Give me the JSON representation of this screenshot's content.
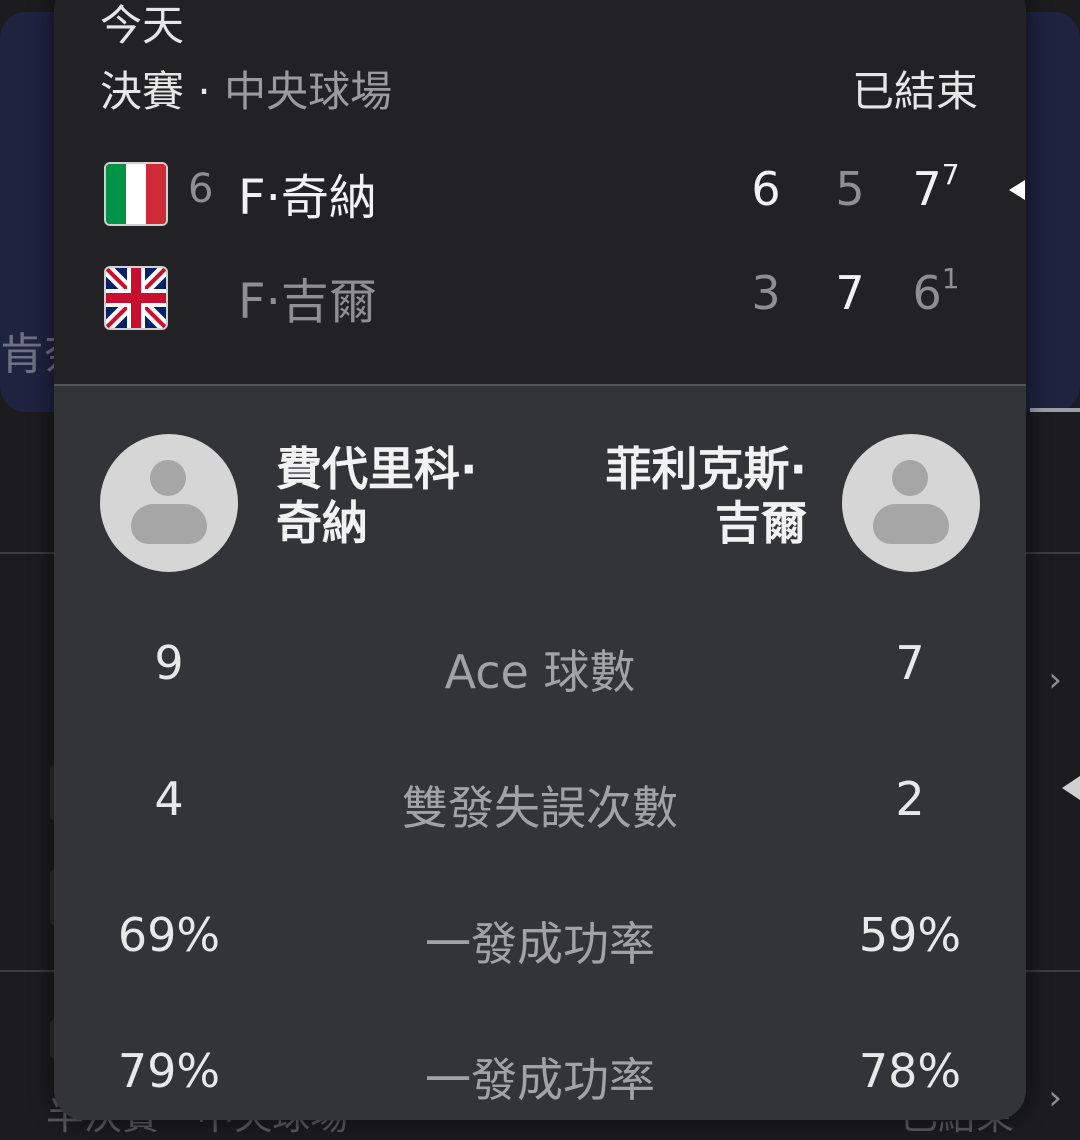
{
  "background": {
    "left_partial_text": "肯奈",
    "bottom_partial_text": "半決賽 · 中央球場",
    "bottom_partial_status": "已結束"
  },
  "match": {
    "date": "今天",
    "round": "決賽",
    "separator": "·",
    "venue": "中央球場",
    "status": "已結束",
    "players": [
      {
        "flag": "italy-flag",
        "seed": "6",
        "short_name": "F·奇納",
        "sets": [
          {
            "score": "6",
            "tiebreak": ""
          },
          {
            "score": "5",
            "tiebreak": ""
          },
          {
            "score": "7",
            "tiebreak": "7"
          }
        ]
      },
      {
        "flag": "uk-flag",
        "seed": "",
        "short_name": "F·吉爾",
        "sets": [
          {
            "score": "3",
            "tiebreak": ""
          },
          {
            "score": "7",
            "tiebreak": ""
          },
          {
            "score": "6",
            "tiebreak": "1"
          }
        ]
      }
    ]
  },
  "stats": {
    "player1_name_line1": "費代里科·",
    "player1_name_line2": "奇納",
    "player2_name_line1": "菲利克斯·",
    "player2_name_line2": "吉爾",
    "rows": [
      {
        "label": "Ace 球數",
        "p1": "9",
        "p2": "7"
      },
      {
        "label": "雙發失誤次數",
        "p1": "4",
        "p2": "2"
      },
      {
        "label": "一發成功率",
        "p1": "69%",
        "p2": "59%"
      },
      {
        "label": "一發成功率",
        "p1": "79%",
        "p2": "78%"
      }
    ]
  },
  "colors": {
    "popup_header": "#222224",
    "popup_body": "#333438",
    "background_band": "#1e2340",
    "italy": [
      "#009246",
      "#ffffff",
      "#ce2b37"
    ],
    "uk_blue": "#012169",
    "uk_red": "#c8102e"
  }
}
